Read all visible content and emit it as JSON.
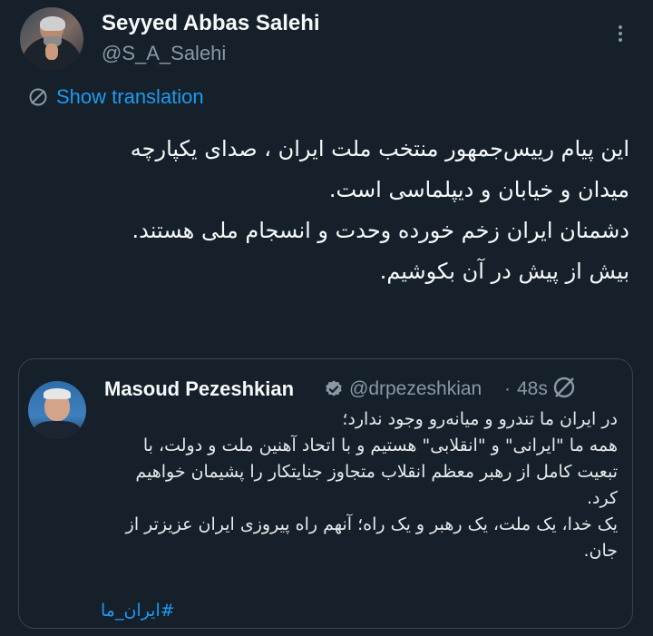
{
  "author": {
    "display_name": "Seyyed Abbas Salehi",
    "handle": "@S_A_Salehi"
  },
  "actions": {
    "more_icon": "more-dots-icon",
    "translate_icon": "translate-globe-icon",
    "translate_label": "Show translation"
  },
  "tweet": {
    "lines": [
      "این پیام رییس‌جمهور منتخب ملت ایران ، صدای یکپارچه",
      "میدان و خیابان و دیپلماسی است.",
      "دشمنان ایران زخم خورده وحدت و انسجام ملی هستند.",
      "بیش از پیش در آن بکوشیم."
    ]
  },
  "quoted_tweet": {
    "display_name": "Masoud Pezeshkian",
    "verified_icon": "verified-badge-icon",
    "handle": "@drpezeshkian",
    "separator": "·",
    "time": "48s",
    "grok_icon": "grok-icon",
    "lines": [
      "در ایران ما تندرو و میانه‌رو وجود ندارد؛",
      "همه ما \"ایرانی\" و \"انقلابی\" هستیم و با اتحاد آهنین ملت و دولت، با",
      "تبعیت کامل از رهبر معظم انقلاب متجاوز جنایتکار را پشیمان خواهیم",
      "کرد.",
      "یک خدا، یک ملت، یک رهبر و یک راه؛ آنهم راه پیروزی ایران عزیزتر از",
      "جان."
    ],
    "hashtag": "#ایران_ما"
  },
  "colors": {
    "background": "#15202b",
    "text": "#f7f9f9",
    "secondary": "#8b98a5",
    "accent": "#1d9bf0",
    "border": "#38444d"
  }
}
